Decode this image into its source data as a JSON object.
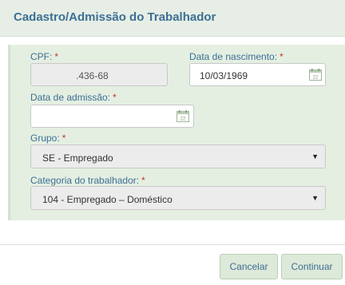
{
  "header": {
    "title": "Cadastro/Admissão do Trabalhador"
  },
  "form": {
    "cpf": {
      "label": "CPF:",
      "required": "*",
      "value": ".436-68"
    },
    "birth_date": {
      "label": "Data de nascimento:",
      "required": "*",
      "value": "10/03/1969"
    },
    "admission_date": {
      "label": "Data de admissão:",
      "required": "*",
      "value": ""
    },
    "group": {
      "label": "Grupo:",
      "required": "*",
      "selected": "SE - Empregado"
    },
    "category": {
      "label": "Categoria do trabalhador:",
      "required": "*",
      "selected": "104 - Empregado – Doméstico"
    }
  },
  "footer": {
    "cancel_label": "Cancelar",
    "continue_label": "Continuar"
  },
  "icons": {
    "calendar": "calendar-icon",
    "dropdown": "triangle-down"
  },
  "colors": {
    "accent": "#3d6f94",
    "required": "#c0392b",
    "panel": "#e4efe2",
    "header": "#e6eee6",
    "button": "#dde9d9"
  }
}
